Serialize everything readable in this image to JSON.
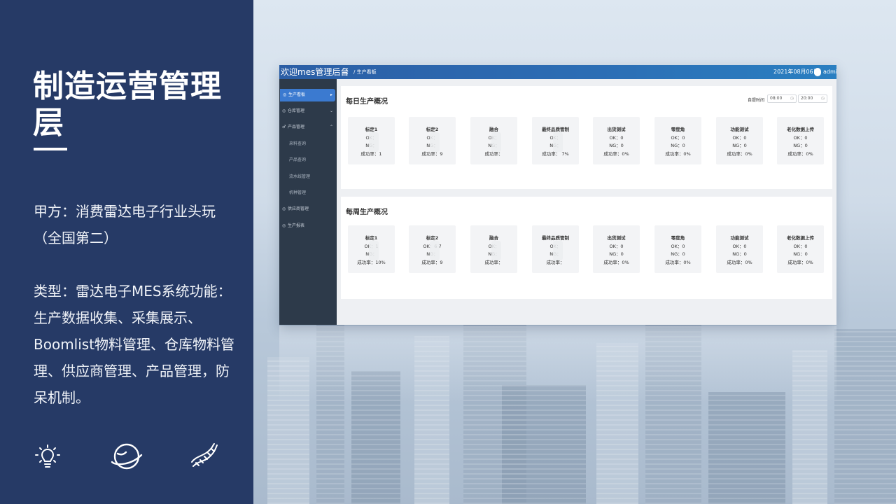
{
  "slide": {
    "title": "制造运营管理层",
    "para1": "甲方：消费雷达电子行业头玩（全国第二）",
    "para2": "类型：雷达电子MES系统功能：生产数据收集、采集展示、Boomlist物料管理、仓库物料管理、供应商管理、产品管理，防呆机制。",
    "icons": [
      "lightbulb-icon",
      "planet-icon",
      "dna-icon"
    ]
  },
  "app": {
    "logo": "欢迎mes管理后台",
    "breadcrumb": "/ 生产看板",
    "date": "2021年08月06日",
    "user": "admin",
    "sidebar": [
      {
        "label": "生产看板",
        "icon": "◎",
        "arrow": "▸",
        "active": true
      },
      {
        "label": "仓库管理",
        "icon": "◎",
        "arrow": "⌄"
      },
      {
        "label": "产品管理",
        "icon": "♂",
        "arrow": "⌃"
      },
      {
        "label": "来料查询",
        "sub": true
      },
      {
        "label": "产品查询",
        "sub": true
      },
      {
        "label": "流水线管理",
        "sub": true
      },
      {
        "label": "机种管理",
        "sub": true
      },
      {
        "label": "供应商管理",
        "icon": "◎"
      },
      {
        "label": "生产报表",
        "icon": "◎"
      }
    ],
    "daily": {
      "title": "每日生产概况",
      "time_label": "自提时间",
      "start": "08:00",
      "end": "20:00",
      "stations": [
        {
          "name": "标定1",
          "ok": "OK：",
          "ng": "NG：",
          "rate": "成功率：1"
        },
        {
          "name": "标定2",
          "ok": "OK：",
          "ng": "NG：",
          "rate": "成功率：9"
        },
        {
          "name": "融合",
          "ok": "OK：",
          "ng": "NG：",
          "rate": "成功率："
        },
        {
          "name": "最终品质管制",
          "ok": "OK：",
          "ng": "NG：",
          "rate": "成功率：  7%"
        },
        {
          "name": "出货测试",
          "ok": "OK：0",
          "ng": "NG：0",
          "rate": "成功率：0%"
        },
        {
          "name": "零度角",
          "ok": "OK：0",
          "ng": "NG：0",
          "rate": "成功率：0%"
        },
        {
          "name": "功能测试",
          "ok": "OK：0",
          "ng": "NG：0",
          "rate": "成功率：0%"
        },
        {
          "name": "老化数据上传",
          "ok": "OK：0",
          "ng": "NG：0",
          "rate": "成功率：0%"
        }
      ]
    },
    "weekly": {
      "title": "每周生产概况",
      "stations": [
        {
          "name": "标定1",
          "ok": "OK：1",
          "ng": "NG：",
          "rate": "成功率：10%"
        },
        {
          "name": "标定2",
          "ok": "OK：6  7",
          "ng": "NG：",
          "rate": "成功率：9"
        },
        {
          "name": "融合",
          "ok": "OK：",
          "ng": "NG：",
          "rate": "成功率："
        },
        {
          "name": "最终品质管制",
          "ok": "OK：",
          "ng": "NG：",
          "rate": "成功率："
        },
        {
          "name": "出货测试",
          "ok": "OK：0",
          "ng": "NG：0",
          "rate": "成功率：0%"
        },
        {
          "name": "零度角",
          "ok": "OK：0",
          "ng": "NG：0",
          "rate": "成功率：0%"
        },
        {
          "name": "功能测试",
          "ok": "OK：0",
          "ng": "NG：0",
          "rate": "成功率：0%"
        },
        {
          "name": "老化数据上传",
          "ok": "OK：0",
          "ng": "NG：0",
          "rate": "成功率：0%"
        }
      ]
    }
  }
}
